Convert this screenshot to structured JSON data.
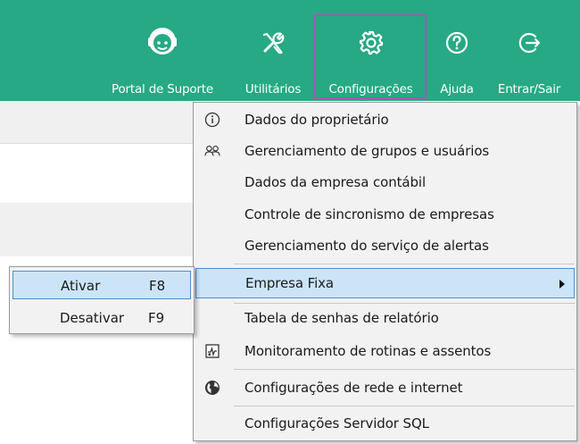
{
  "toolbar": {
    "accent_color": "#26a984",
    "buttons": [
      {
        "label": "Portal de Suporte",
        "icon": "support-agent-icon"
      },
      {
        "label": "Utilitários",
        "icon": "tools-icon"
      },
      {
        "label": "Configurações",
        "icon": "gear-icon"
      },
      {
        "label": "Ajuda",
        "icon": "help-icon"
      },
      {
        "label": "Entrar/Sair",
        "icon": "login-logout-icon"
      }
    ]
  },
  "menu": {
    "items": [
      {
        "label": "Dados do proprietário",
        "icon": "info-icon"
      },
      {
        "label": "Gerenciamento de grupos e usuários",
        "icon": "users-icon"
      },
      {
        "label": "Dados da empresa contábil"
      },
      {
        "label": "Controle de sincronismo de empresas"
      },
      {
        "label": "Gerenciamento do serviço de alertas"
      },
      {
        "label": "Empresa Fixa",
        "has_submenu": true
      },
      {
        "label": "Tabela de senhas de relatório"
      },
      {
        "label": "Monitoramento de rotinas e assentos",
        "icon": "monitor-icon"
      },
      {
        "label": "Configurações de rede e internet",
        "icon": "globe-icon"
      },
      {
        "label": "Configurações Servidor SQL"
      }
    ]
  },
  "submenu": {
    "items": [
      {
        "label": "Ativar",
        "shortcut": "F8"
      },
      {
        "label": "Desativar",
        "shortcut": "F9"
      }
    ]
  }
}
